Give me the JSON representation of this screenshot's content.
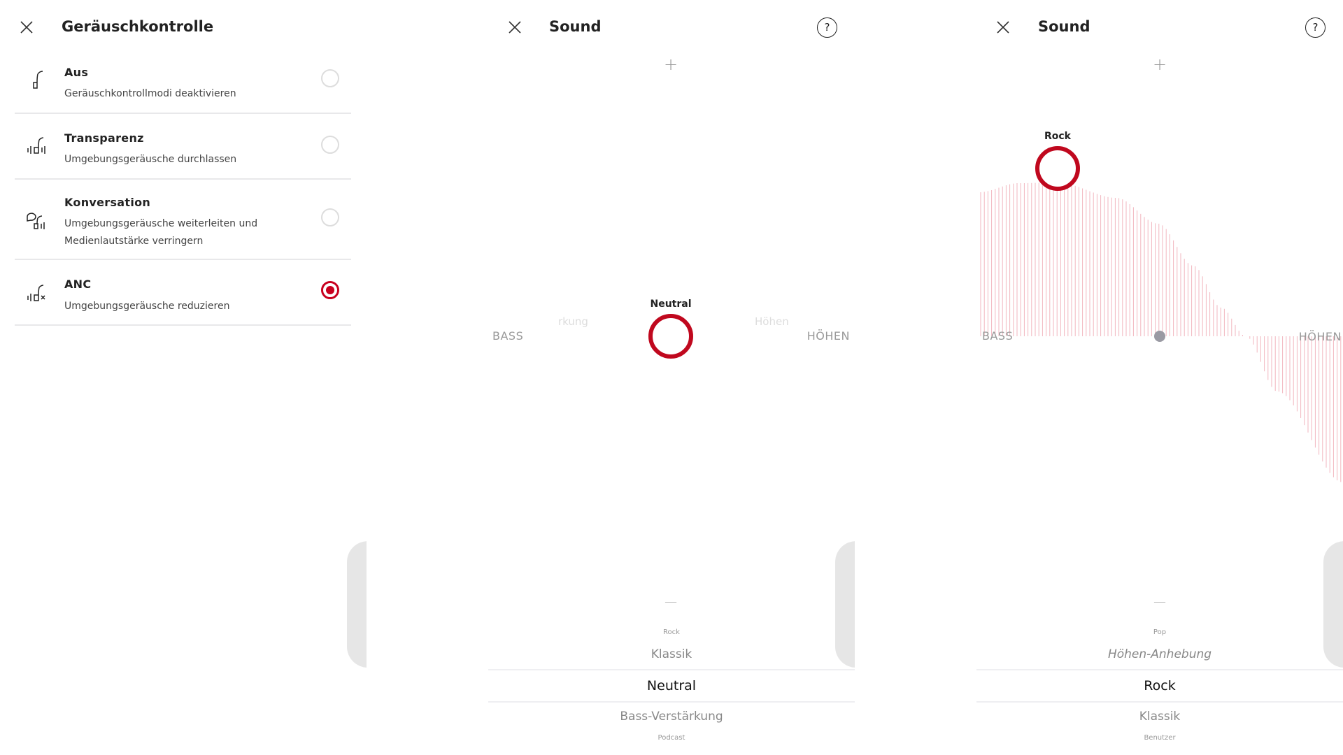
{
  "noise_control": {
    "title": "Geräuschkontrolle",
    "options": [
      {
        "label": "Aus",
        "description": "Geräuschkontrollmodi deaktivieren",
        "selected": false,
        "icon": "earbud-off-icon"
      },
      {
        "label": "Transparenz",
        "description": "Umgebungsgeräusche durchlassen",
        "selected": false,
        "icon": "transparency-icon"
      },
      {
        "label": "Konversation",
        "description_line1": "Umgebungsgeräusche weiterleiten und",
        "description_line2": "Medienlautstärke verringern",
        "selected": false,
        "icon": "conversation-icon"
      },
      {
        "label": "ANC",
        "description": "Umgebungsgeräusche reduzieren",
        "selected": true,
        "icon": "anc-icon"
      }
    ]
  },
  "sound_neutral": {
    "title": "Sound",
    "plus": "+",
    "minus": "—",
    "bass_label": "BASS",
    "treble_label": "HÖHEN",
    "faint_left": "rkung",
    "faint_right": "Höhen",
    "preset_label": "Neutral",
    "picker": {
      "above_small": "Rock",
      "above": "Klassik",
      "selected": "Neutral",
      "below": "Bass-Verstärkung",
      "below_small": "Podcast"
    }
  },
  "sound_rock": {
    "title": "Sound",
    "plus": "+",
    "minus": "—",
    "bass_label": "BASS",
    "treble_label": "HÖHEN",
    "preset_label": "Rock",
    "picker": {
      "above_small": "Pop",
      "above": "Höhen-Anhebung",
      "selected": "Rock",
      "below": "Klassik",
      "below_small": "Benutzer"
    }
  },
  "help_symbol": "?",
  "colors": {
    "accent": "#c0081e",
    "eq_bars": "#f2b6bf",
    "neutral_dot": "#9a9aa3"
  }
}
